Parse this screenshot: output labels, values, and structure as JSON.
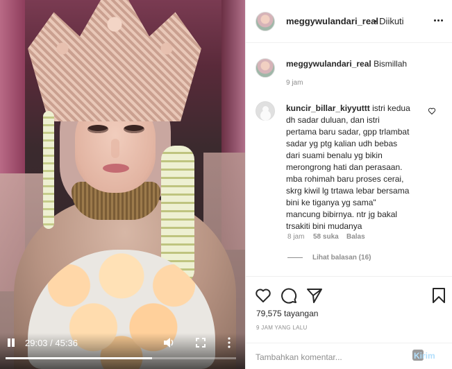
{
  "video": {
    "current_time": "29:03",
    "separator": "/",
    "duration": "45:36",
    "progress_fraction": 0.637
  },
  "header": {
    "username": "meggywulandari_real",
    "follow_status": "• Diikuti"
  },
  "caption": {
    "username": "meggywulandari_real",
    "text": "Bismillah",
    "time": "9 jam"
  },
  "comments": [
    {
      "username": "kuncir_billar_kiyyuttt",
      "lines": [
        "istri kedua",
        "dh sadar duluan, dan istri",
        "pertama baru sadar, gpp trlambat",
        "sadar yg ptg kalian udh bebas",
        "dari suami benalu yg bikin",
        "merongrong hati dan perasaan.",
        "mba rohimah baru proses cerai,",
        "skrg kiwil lg trtawa lebar bersama",
        "bini ke tiganya yg sama\"",
        "mancung bibirnya. ntr jg bakal",
        "trsakiti bini mudanya"
      ],
      "time": "8 jam",
      "likes": "58 suka",
      "reply_label": "Balas",
      "view_replies": "Lihat balasan (16)"
    }
  ],
  "footer": {
    "views": "79,575 tayangan",
    "date": "9 JAM YANG LALU",
    "comment_placeholder": "Tambahkan komentar...",
    "send_label": "Kirim"
  },
  "icons": {
    "like": "heart-icon",
    "comment": "comment-icon",
    "share": "send-icon",
    "save": "bookmark-icon",
    "pause": "pause-icon",
    "volume": "volume-icon",
    "fullscreen": "fullscreen-icon",
    "more": "more-icon"
  }
}
